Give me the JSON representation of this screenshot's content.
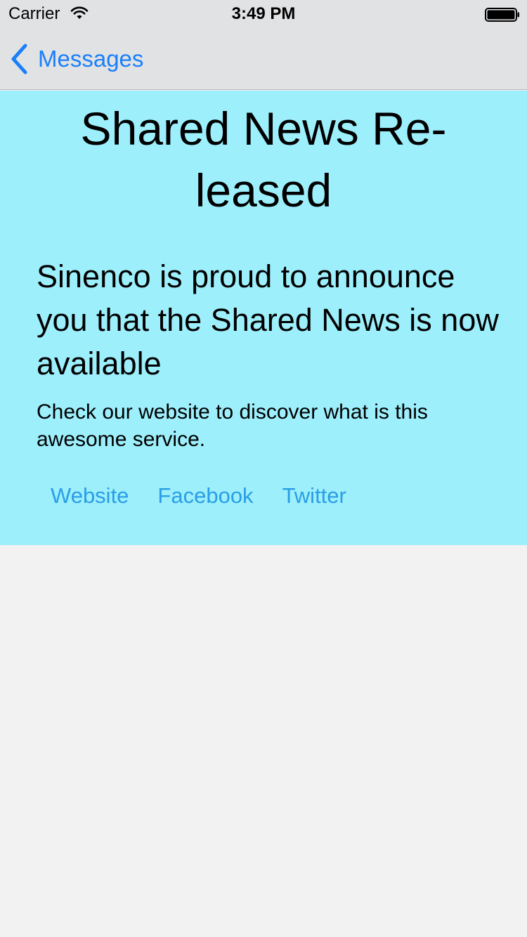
{
  "status_bar": {
    "carrier": "Carrier",
    "time": "3:49 PM",
    "wifi_icon": "wifi-icon",
    "battery_icon": "battery-full-icon"
  },
  "nav_bar": {
    "back_label": "Messages",
    "back_icon": "chevron-left-icon",
    "accent_color": "#1a7ffb"
  },
  "message": {
    "background_color": "#9deffc",
    "title": "Shared News Re-leased",
    "headline": "Sinenco is proud to announce you that the Shared News is now available",
    "body": "Check our website to discover what is this awesome service.",
    "link_color": "#2a9ee6",
    "links": [
      {
        "label": "Website"
      },
      {
        "label": "Facebook"
      },
      {
        "label": "Twitter"
      }
    ]
  }
}
